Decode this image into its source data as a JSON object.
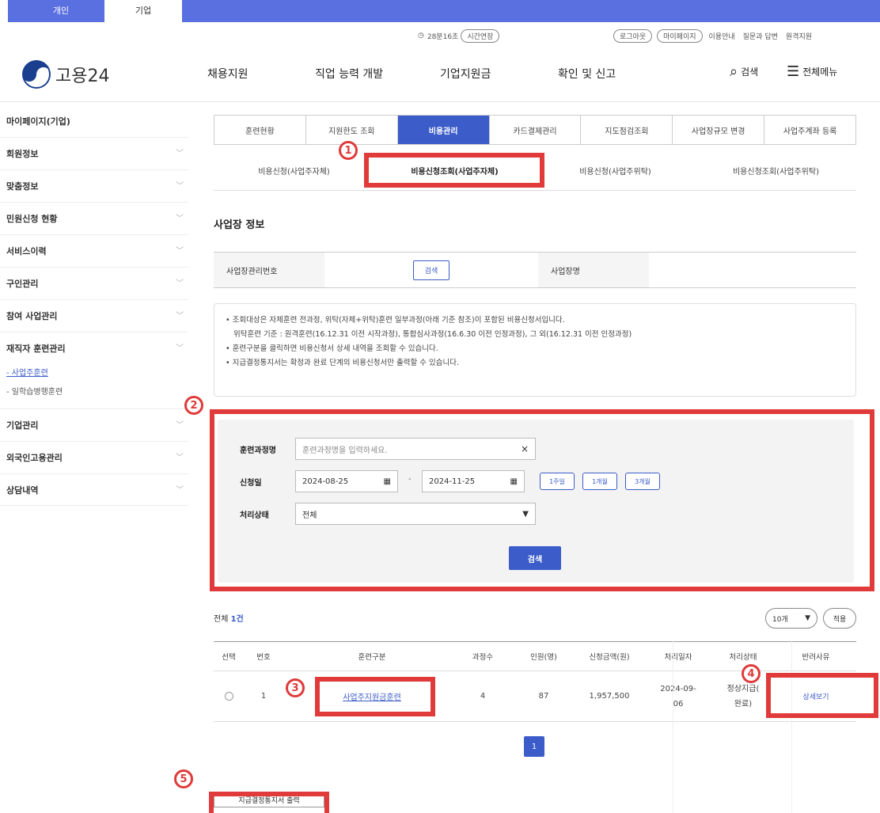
{
  "topbar": {
    "tab_personal": "개인",
    "tab_company": "기업"
  },
  "util": {
    "timer": "28분16초",
    "extend": "시간연장",
    "logout": "로그아웃",
    "mypage": "마이페이지",
    "guide": "이용안내",
    "qa": "질문과 답변",
    "remote": "원격지원"
  },
  "header": {
    "logo": "고용24",
    "menu": [
      "채용지원",
      "직업 능력 개발",
      "기업지원금",
      "확인 및 신고"
    ],
    "search": "검색",
    "all_menu": "전체메뉴"
  },
  "sidebar": {
    "title": "마이페이지(기업)",
    "items": [
      {
        "label": "회원정보"
      },
      {
        "label": "맞춤정보"
      },
      {
        "label": "민원신청 현황"
      },
      {
        "label": "서비스이력"
      },
      {
        "label": "구인관리"
      },
      {
        "label": "참여 사업관리"
      },
      {
        "label": "재직자 훈련관리"
      }
    ],
    "subs": [
      "- 사업주훈련",
      "- 일학습병행훈련"
    ],
    "items2": [
      {
        "label": "기업관리"
      },
      {
        "label": "외국인고용관리"
      },
      {
        "label": "상담내역"
      }
    ]
  },
  "tabs": [
    "훈련현황",
    "지원한도 조회",
    "비용관리",
    "카드결제관리",
    "지도점검조회",
    "사업장규모 변경",
    "사업주계좌 등록"
  ],
  "subtabs": [
    "비용신청(사업주자체)",
    "비용신청조회(사업주자체)",
    "비용신청(사업주위탁)",
    "비용신청조회(사업주위탁)"
  ],
  "section_title": "사업장 정보",
  "info": {
    "mgmt_no_label": "사업장관리번호",
    "search_btn": "검색",
    "name_label": "사업장명"
  },
  "notice": {
    "line1": "• 조회대상은 자체훈련 전과정, 위탁(자체+위탁)훈련 일부과정(아래 기준 참조)이 포함된 비용신청서입니다.",
    "line2": "위탁훈련 기준 : 원격훈련(16.12.31 이전 시작과정), 통합심사과정(16.6.30 이전 인정과정), 그 외(16.12.31 이전 인정과정)",
    "line3": "• 훈련구분을 클릭하면 비용신청서 상세 내역을 조회할 수 있습니다.",
    "line4": "• 지급결정통지서는 확정과 완료 단계의 비용신청서만 출력할 수 있습니다."
  },
  "search": {
    "course_label": "훈련과정명",
    "course_placeholder": "훈련과정명을 입력하세요.",
    "date_label": "신청일",
    "date_from": "2024-08-25",
    "date_to": "2024-11-25",
    "range1": "1주일",
    "range2": "1개월",
    "range3": "3개월",
    "status_label": "처리상태",
    "status_value": "전체",
    "search_btn": "검색"
  },
  "results": {
    "total_label": "전체",
    "total_count": "1건",
    "page_size": "10개",
    "apply": "적용",
    "columns": [
      "선택",
      "번호",
      "훈련구분",
      "과정수",
      "인원(명)",
      "신청금액(원)",
      "처리일자",
      "처리상태",
      "반려사유"
    ],
    "rows": [
      {
        "no": "1",
        "type": "사업주지원금훈련",
        "courses": "4",
        "people": "87",
        "amount": "1,957,500",
        "date1": "2024-09-",
        "date2": "06",
        "status1": "정상지급(",
        "status2": "완료)",
        "reason": "상세보기"
      }
    ],
    "page": "1"
  },
  "print_btn": "지급결정통지서 출력",
  "badges": [
    "1",
    "2",
    "3",
    "4",
    "5"
  ],
  "colors": {
    "brand": "#3b5cc9",
    "top": "#5a6fe0",
    "highlight": "#e03a3a"
  }
}
